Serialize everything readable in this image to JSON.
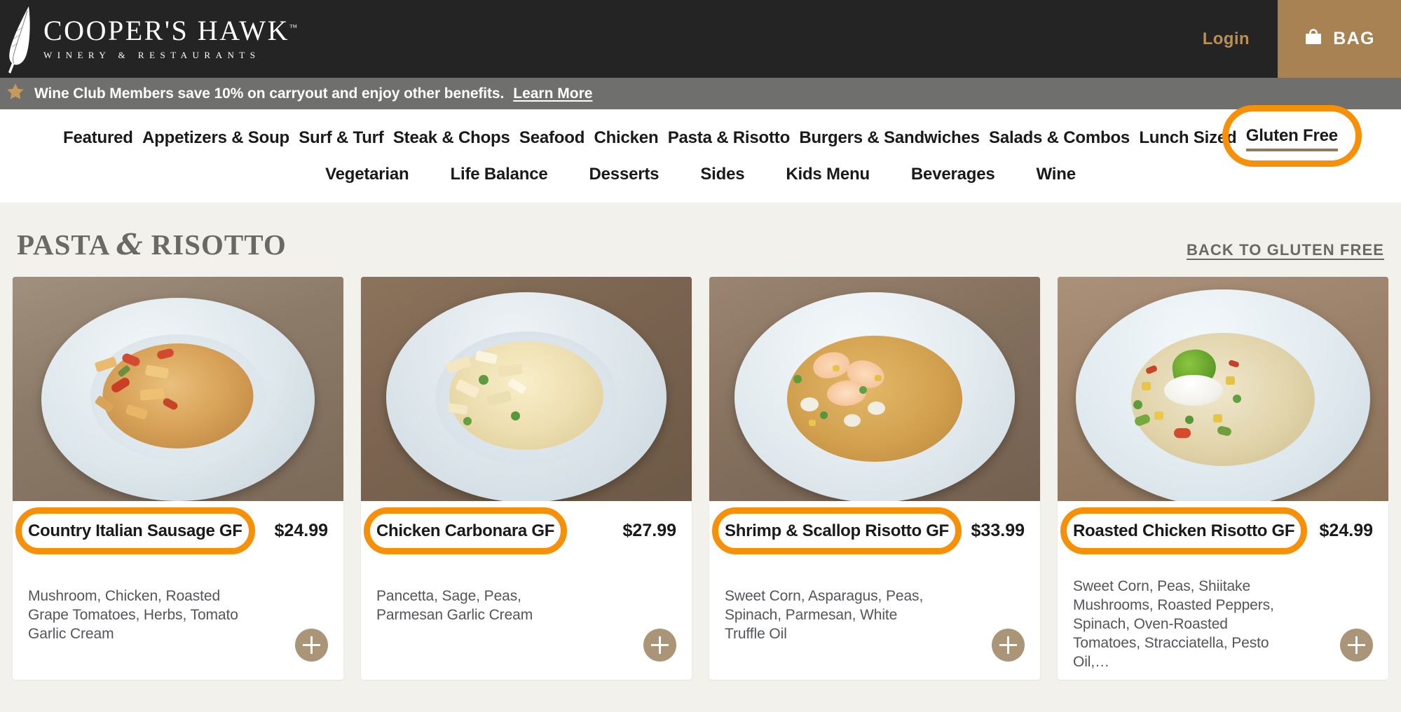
{
  "header": {
    "logo_name": "COOPER'S HAWK",
    "logo_tm": "™",
    "logo_sub": "WINERY & RESTAURANTS",
    "logo_icon": "feather-icon",
    "login_label": "Login",
    "bag_label": "BAG",
    "bag_icon": "shopping-bag-icon",
    "bg_color": "#242424",
    "accent_color": "#a98254"
  },
  "promo": {
    "star_icon": "star-icon",
    "text": "Wine Club Members save 10% on carryout and enjoy other benefits.",
    "link_label": "Learn More",
    "bg_color": "#6f6f6e"
  },
  "nav": {
    "row1": [
      {
        "label": "Featured",
        "active": false
      },
      {
        "label": "Appetizers & Soup",
        "active": false
      },
      {
        "label": "Surf & Turf",
        "active": false
      },
      {
        "label": "Steak & Chops",
        "active": false
      },
      {
        "label": "Seafood",
        "active": false
      },
      {
        "label": "Chicken",
        "active": false
      },
      {
        "label": "Pasta & Risotto",
        "active": false
      },
      {
        "label": "Burgers & Sandwiches",
        "active": false
      },
      {
        "label": "Salads & Combos",
        "active": false
      },
      {
        "label": "Lunch Sized",
        "active": false
      },
      {
        "label": "Gluten Free",
        "active": true,
        "highlighted": true
      }
    ],
    "row2": [
      {
        "label": "Vegetarian"
      },
      {
        "label": "Life Balance"
      },
      {
        "label": "Desserts"
      },
      {
        "label": "Sides"
      },
      {
        "label": "Kids Menu"
      },
      {
        "label": "Beverages"
      },
      {
        "label": "Wine"
      }
    ],
    "highlight_color": "#f79009",
    "active_underline_color": "#8f7a5e"
  },
  "main": {
    "section_title_part1": "PASTA ",
    "section_title_amp": "&",
    "section_title_part2": " RISOTTO",
    "back_link": "BACK TO GLUTEN FREE",
    "add_icon": "plus-icon",
    "items": [
      {
        "name": "Country Italian Sausage GF",
        "price": "$24.99",
        "description": "Mushroom, Chicken, Roasted Grape Tomatoes, Herbs, Tomato Garlic Cream",
        "photo": "penne-pasta-with-tomatoes",
        "highlighted": true
      },
      {
        "name": "Chicken Carbonara GF",
        "price": "$27.99",
        "description": "Pancetta, Sage, Peas, Parmesan Garlic Cream",
        "photo": "creamy-penne-carbonara",
        "highlighted": true
      },
      {
        "name": "Shrimp & Scallop Risotto GF",
        "price": "$33.99",
        "description": "Sweet Corn, Asparagus, Peas, Spinach, Parmesan, White Truffle Oil",
        "photo": "shrimp-scallop-risotto",
        "highlighted": true
      },
      {
        "name": "Roasted Chicken Risotto GF",
        "price": "$24.99",
        "description": "Sweet Corn, Peas, Shiitake Mushrooms, Roasted Peppers, Spinach, Oven-Roasted Tomatoes, Stracciatella, Pesto Oil,…",
        "photo": "roasted-chicken-risotto-with-basil",
        "highlighted": true
      }
    ]
  }
}
